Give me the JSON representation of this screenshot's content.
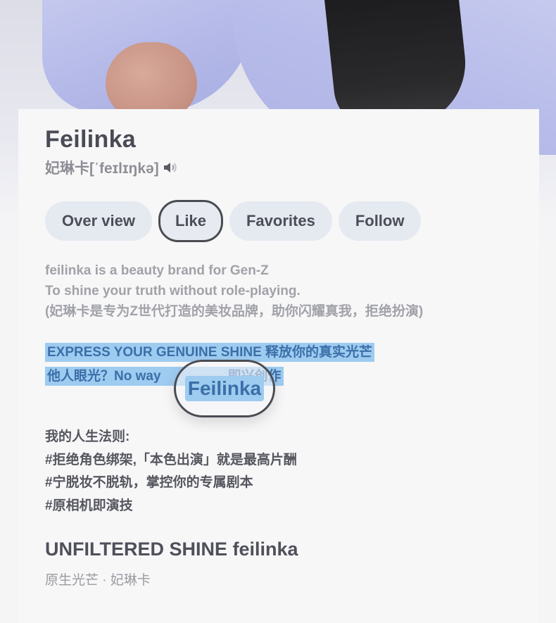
{
  "brand": {
    "name": "Feilinka",
    "subtitle": "妃琳卡[ˈfeɪlɪŋkə]",
    "speaker_icon": "speaker-icon"
  },
  "tabs": [
    {
      "label": "Over view",
      "active": false
    },
    {
      "label": "Like",
      "active": true
    },
    {
      "label": "Favorites",
      "active": false
    },
    {
      "label": "Follow",
      "active": false
    }
  ],
  "description": {
    "line1": "feilinka is a beauty brand for Gen-Z",
    "line2": "To shine your truth without role-playing.",
    "line3": "(妃琳卡是专为Z世代打造的美妆品牌，助你闪耀真我，拒绝扮演)"
  },
  "highlight": {
    "line1": "EXPRESS YOUR GENUINE SHINE 释放你的真实光芒",
    "line2": "他人眼光？No way                  即兴创作",
    "bubble_text": "Feilinka"
  },
  "rules": {
    "heading": "我的人生法则:",
    "items": [
      "#拒绝角色绑架,「本色出演」就是最高片酬",
      "#宁脱妆不脱轨，掌控你的专属剧本",
      "#原相机即演技"
    ]
  },
  "footer": {
    "title": "UNFILTERED SHINE feilinka",
    "subtitle": "原生光芒 · 妃琳卡"
  },
  "colors": {
    "highlight_bg": "#9ecbf0",
    "highlight_text": "#3b6fa8",
    "tab_bg": "#e5e9f0",
    "shirt": "#b7bcea"
  }
}
